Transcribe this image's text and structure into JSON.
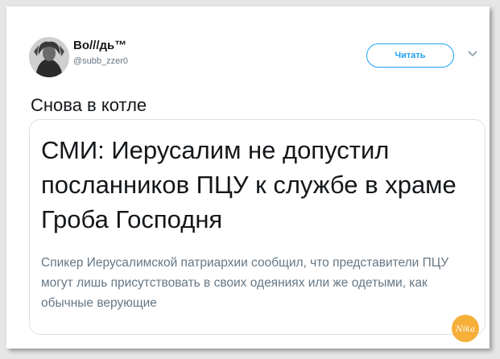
{
  "author": {
    "display_name": "Во///дь™",
    "handle": "@subb_zzer0"
  },
  "follow_button": {
    "label": "Читать"
  },
  "tweet": {
    "text": "Снова в котле"
  },
  "link_card": {
    "headline": "СМИ: Иерусалим не допустил посланников ПЦУ к службе в храме Гроба Господня",
    "summary": "Спикер Иерусалимской патриархии сообщил, что представители ПЦУ могут лишь присутствовать в своих одеяниях или же одетыми, как обычные верующие"
  },
  "watermark": {
    "text": "Nika"
  },
  "colors": {
    "accent": "#1da1f2",
    "text_primary": "#14171a",
    "text_secondary": "#657786",
    "card_border": "#dcdfe2",
    "watermark": "#f5a623"
  }
}
